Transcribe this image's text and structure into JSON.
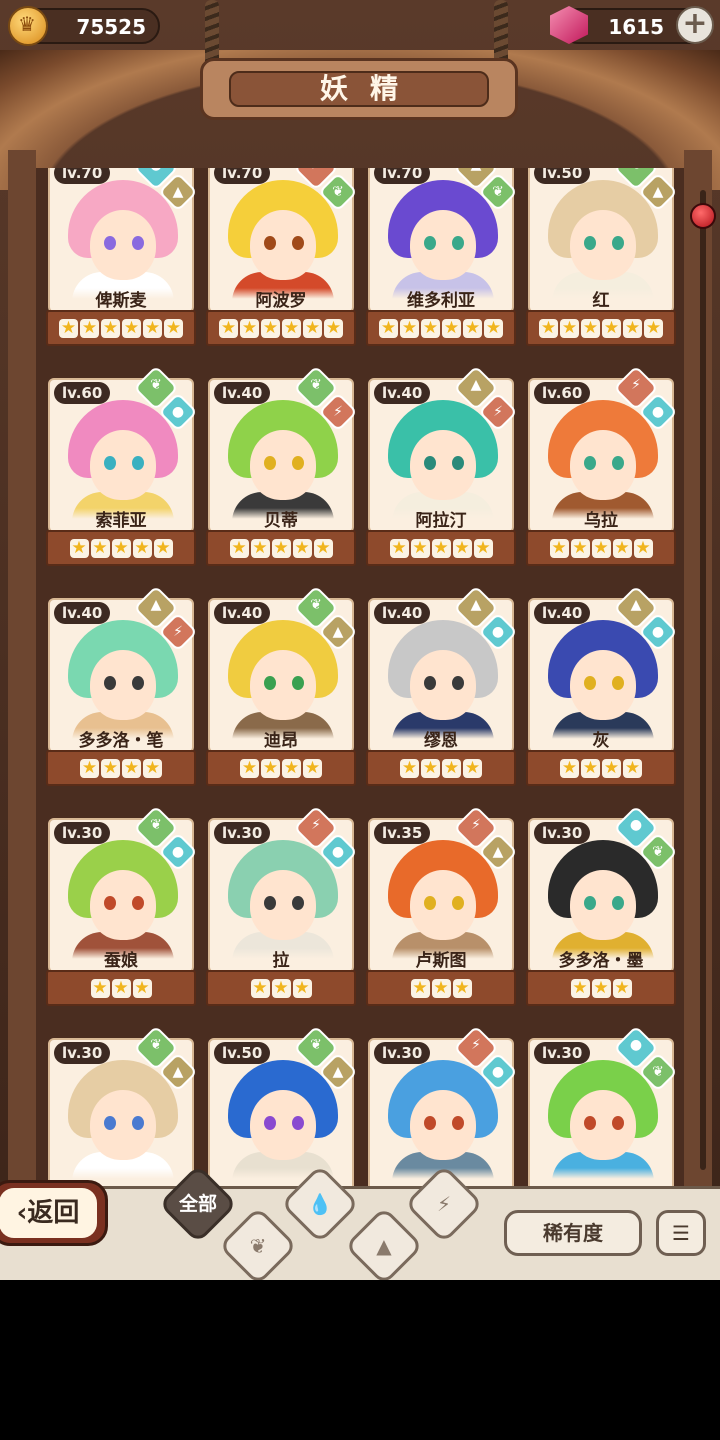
{
  "header": {
    "gold": "75525",
    "gems": "1615",
    "title": "妖精",
    "gold_icon": "crown-coin-icon",
    "gem_icon": "pink-gem-icon",
    "add_icon": "plus-icon"
  },
  "colors": {
    "plant": "#7cc06a",
    "water": "#5fc9d0",
    "fire": "#d2765c",
    "earth": "#b8a264",
    "star": "#f0b51e"
  },
  "fairies": [
    {
      "level": "lv.70",
      "name": "俾斯麦",
      "stars": 6,
      "elements": [
        "water",
        "earth"
      ],
      "hair": "#f7a8c4",
      "body": "#ffffff",
      "eye": "#8a6adf"
    },
    {
      "level": "lv.70",
      "name": "阿波罗",
      "stars": 6,
      "elements": [
        "fire",
        "plant"
      ],
      "hair": "#f5cf3a",
      "body": "#d44a2a",
      "eye": "#a04a1a"
    },
    {
      "level": "lv.70",
      "name": "维多利亚",
      "stars": 6,
      "elements": [
        "earth",
        "plant"
      ],
      "hair": "#6a4ad0",
      "body": "#c7c2e8",
      "eye": "#3aa88a"
    },
    {
      "level": "lv.50",
      "name": "红",
      "stars": 6,
      "elements": [
        "plant",
        "earth"
      ],
      "hair": "#e6cda4",
      "body": "#f5eede",
      "eye": "#3aa88a"
    },
    {
      "level": "lv.60",
      "name": "索菲亚",
      "stars": 5,
      "elements": [
        "plant",
        "water"
      ],
      "hair": "#f08ac0",
      "body": "#f3d36a",
      "eye": "#3ab0c0"
    },
    {
      "level": "lv.40",
      "name": "贝蒂",
      "stars": 5,
      "elements": [
        "plant",
        "fire"
      ],
      "hair": "#8fd24a",
      "body": "#3a3a3a",
      "eye": "#e0b020"
    },
    {
      "level": "lv.40",
      "name": "阿拉汀",
      "stars": 5,
      "elements": [
        "earth",
        "fire"
      ],
      "hair": "#3ac0a8",
      "body": "#f5eede",
      "eye": "#2a8a7a"
    },
    {
      "level": "lv.60",
      "name": "乌拉",
      "stars": 5,
      "elements": [
        "fire",
        "water"
      ],
      "hair": "#ee7a3a",
      "body": "#a05a30",
      "eye": "#3aa88a"
    },
    {
      "level": "lv.40",
      "name": "多多洛・笔",
      "stars": 4,
      "elements": [
        "earth",
        "fire"
      ],
      "hair": "#7ad8b0",
      "body": "#e8c090",
      "eye": "#3a3a3a"
    },
    {
      "level": "lv.40",
      "name": "迪昂",
      "stars": 4,
      "elements": [
        "plant",
        "earth"
      ],
      "hair": "#f0cc40",
      "body": "#8a6a4a",
      "eye": "#3aa050"
    },
    {
      "level": "lv.40",
      "name": "缪恩",
      "stars": 4,
      "elements": [
        "earth",
        "water"
      ],
      "hair": "#c8c8c8",
      "body": "#2a3a6a",
      "eye": "#3a3a3a"
    },
    {
      "level": "lv.40",
      "name": "灰",
      "stars": 4,
      "elements": [
        "earth",
        "water"
      ],
      "hair": "#3a4ab0",
      "body": "#2a3a5a",
      "eye": "#e0b020"
    },
    {
      "level": "lv.30",
      "name": "蚕娘",
      "stars": 3,
      "elements": [
        "plant",
        "water"
      ],
      "hair": "#9ad04a",
      "body": "#a0523a",
      "eye": "#c04a2a"
    },
    {
      "level": "lv.30",
      "name": "拉",
      "stars": 3,
      "elements": [
        "fire",
        "water"
      ],
      "hair": "#8ad0b0",
      "body": "#ece6da",
      "eye": "#3a3a3a"
    },
    {
      "level": "lv.35",
      "name": "卢斯图",
      "stars": 3,
      "elements": [
        "fire",
        "earth"
      ],
      "hair": "#e86a2a",
      "body": "#b8906a",
      "eye": "#e0b020"
    },
    {
      "level": "lv.30",
      "name": "多多洛・墨",
      "stars": 3,
      "elements": [
        "water",
        "plant"
      ],
      "hair": "#2a2a2a",
      "body": "#e0b030",
      "eye": "#3aa88a"
    },
    {
      "level": "lv.30",
      "name": "",
      "stars": 0,
      "elements": [
        "plant",
        "earth"
      ],
      "hair": "#e6cda4",
      "body": "#ffffff",
      "eye": "#4a7ad0"
    },
    {
      "level": "lv.50",
      "name": "",
      "stars": 0,
      "elements": [
        "plant",
        "earth"
      ],
      "hair": "#2a6ad0",
      "body": "#e8e0d0",
      "eye": "#8a4ad0"
    },
    {
      "level": "lv.30",
      "name": "",
      "stars": 0,
      "elements": [
        "fire",
        "water"
      ],
      "hair": "#4aa0e0",
      "body": "#6a8aa0",
      "eye": "#c04a2a"
    },
    {
      "level": "lv.30",
      "name": "",
      "stars": 0,
      "elements": [
        "water",
        "plant"
      ],
      "hair": "#7ad04a",
      "body": "#4ab0e0",
      "eye": "#c04a2a"
    }
  ],
  "footer": {
    "back_label": "返回",
    "tabs": [
      {
        "label": "全部",
        "icon": "all-icon"
      },
      {
        "label": "",
        "icon": "plant-sprout-icon"
      },
      {
        "label": "",
        "icon": "water-drop-icon"
      },
      {
        "label": "",
        "icon": "earth-mountain-icon"
      },
      {
        "label": "",
        "icon": "fire-volcano-icon"
      }
    ],
    "rarity_label": "稀有度",
    "sort_icon": "sort-list-icon"
  }
}
